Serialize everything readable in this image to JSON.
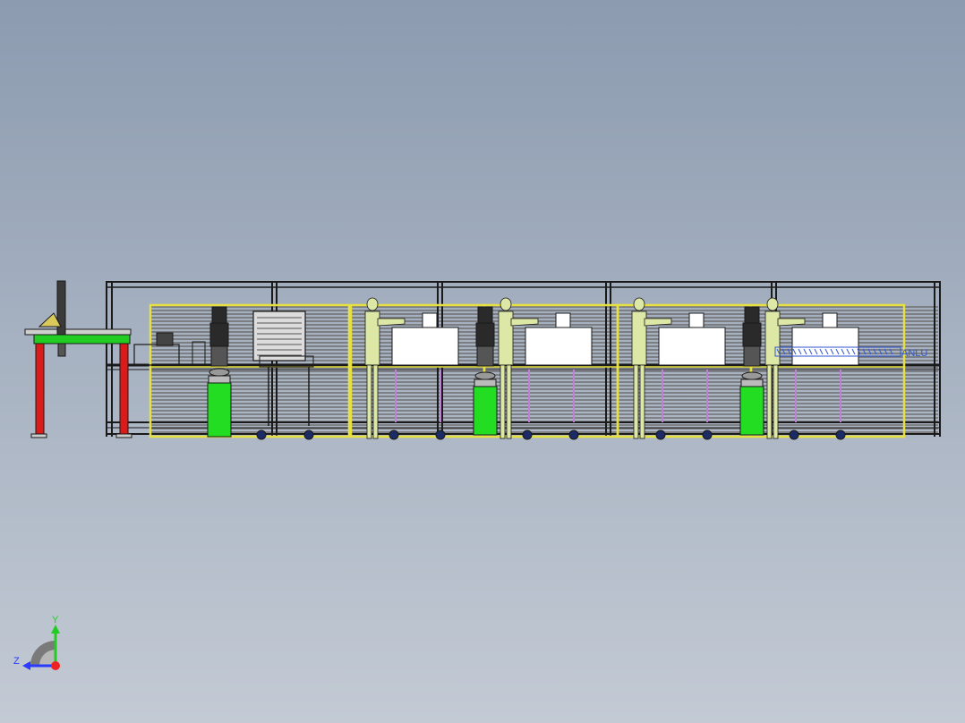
{
  "view": {
    "background_top": "#8c9bb0",
    "background_bottom": "#c3cad4"
  },
  "model": {
    "stations": 4,
    "overlay_text": "ANLU",
    "overlay_color": "#3355cc",
    "colors": {
      "frame": "#1a1a1a",
      "guard": "#e6e040",
      "louver": "#6e6e6e",
      "panel_fill": "#dcdcdc",
      "machine_box": "#ffffff",
      "operator": "#dde7a6",
      "pedestal": "#22dd22",
      "robot": "#2a2a2a",
      "caster": "#1c2a66",
      "rail": "#c080d8",
      "conveyor_top": "#22cc22",
      "conveyor_leg": "#dd1a1a"
    }
  },
  "triad": {
    "y_label": "Y",
    "z_label": "Z",
    "y_color": "#22cc22",
    "z_color": "#2a3aff",
    "origin_color": "#ee2222"
  }
}
